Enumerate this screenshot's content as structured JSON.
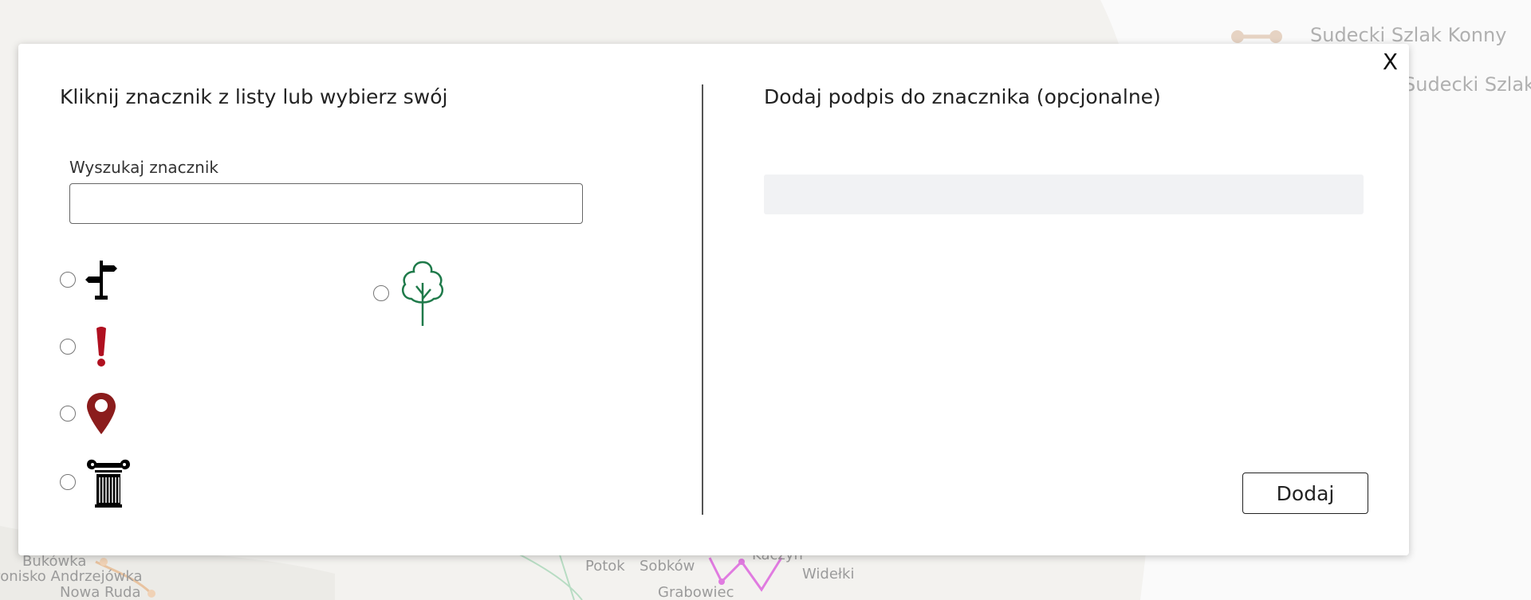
{
  "map": {
    "legend": [
      {
        "label": "Sudecki Szlak Konny"
      },
      {
        "label": "Sudecki Szlak"
      }
    ],
    "places": [
      "Bukówka",
      "Ponisko Andrzejówka",
      "Nowa Ruda",
      "Potok",
      "Sobków",
      "Kaczyn",
      "Widełki",
      "Grabowiec"
    ]
  },
  "modal": {
    "close_label": "X",
    "left": {
      "title": "Kliknij znacznik z listy lub wybierz swój",
      "search": {
        "label": "Wyszukaj znacznik",
        "value": "",
        "placeholder": ""
      },
      "markers": [
        {
          "icon": "signpost-icon",
          "color": "#000000",
          "selected": false
        },
        {
          "icon": "exclamation-icon",
          "color": "#b01020",
          "selected": false
        },
        {
          "icon": "map-pin-icon",
          "color": "#8b1c1c",
          "selected": false
        },
        {
          "icon": "column-icon",
          "color": "#000000",
          "selected": false
        },
        {
          "icon": "tree-icon",
          "color": "#1f7a4a",
          "selected": false
        }
      ]
    },
    "right": {
      "title": "Dodaj podpis do znacznika (opcjonalne)",
      "caption": {
        "value": "",
        "placeholder": ""
      },
      "add_label": "Dodaj"
    }
  }
}
